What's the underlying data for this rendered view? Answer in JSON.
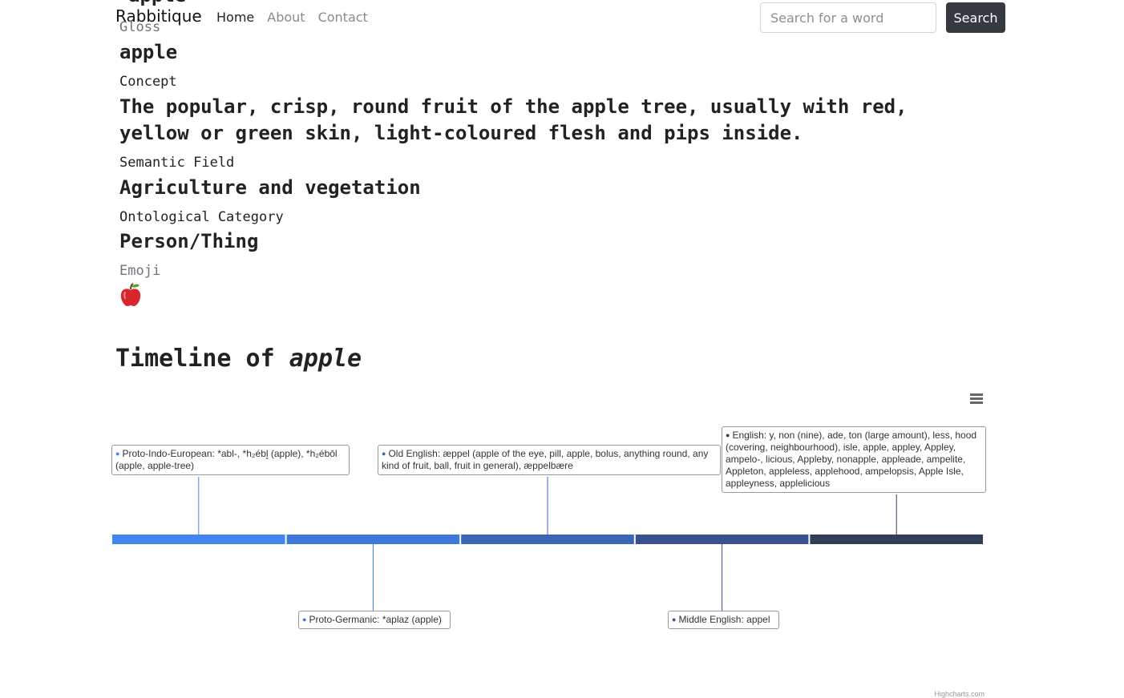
{
  "navbar": {
    "brand": "Rabbitique",
    "links": [
      {
        "label": "Home",
        "active": true
      },
      {
        "label": "About",
        "active": false
      },
      {
        "label": "Contact",
        "active": false
      }
    ],
    "search_placeholder": "Search for a word",
    "search_button": "Search"
  },
  "details": {
    "gloss_label": "Gloss",
    "gloss_value": "apple",
    "concept_label": "Concept",
    "concept_value": "The popular, crisp, round fruit of the apple tree, usually with red, yellow or green skin, light-coloured flesh and pips inside.",
    "semantic_field_label": "Semantic Field",
    "semantic_field_value": "Agriculture and vegetation",
    "ontological_label": "Ontological Category",
    "ontological_value": "Person/Thing",
    "emoji_label": "Emoji",
    "emoji_icon": "red-apple-icon"
  },
  "timeline": {
    "title_prefix": "Timeline of",
    "title_word": "apple",
    "menu_icon": "hamburger-menu-icon",
    "credits": "Highcharts.com"
  },
  "chart_data": {
    "type": "timeline",
    "events": [
      {
        "name": "Proto-Indo-European",
        "words": "*abl-, *h₂ébl̥ (apple), *h₂ébōl (apple, apple-tree)",
        "color": "#4185f3",
        "label_side": "above"
      },
      {
        "name": "Proto-Germanic",
        "words": "*aplaz (apple)",
        "color": "#3d79d9",
        "label_side": "below"
      },
      {
        "name": "Old English",
        "words": "æppel (apple of the eye, pill, apple, bolus, anything round, any kind of fruit, ball, fruit in general), æppelbære",
        "color": "#3a66b8",
        "label_side": "above"
      },
      {
        "name": "Middle English",
        "words": "appel",
        "color": "#37528e",
        "label_side": "below"
      },
      {
        "name": "English",
        "words": "y, non (nine), ade, ton (large amount), less, hood (covering, neighbourhood), isle, apple, appley, Appley, ampelo-, licious, Appleby, nonapple, appleade, ampelite, Appleton, appleless, applehood, ampelopsis, Apple Isle, appleyness, applelicious",
        "color": "#323e58",
        "label_side": "above"
      }
    ]
  }
}
